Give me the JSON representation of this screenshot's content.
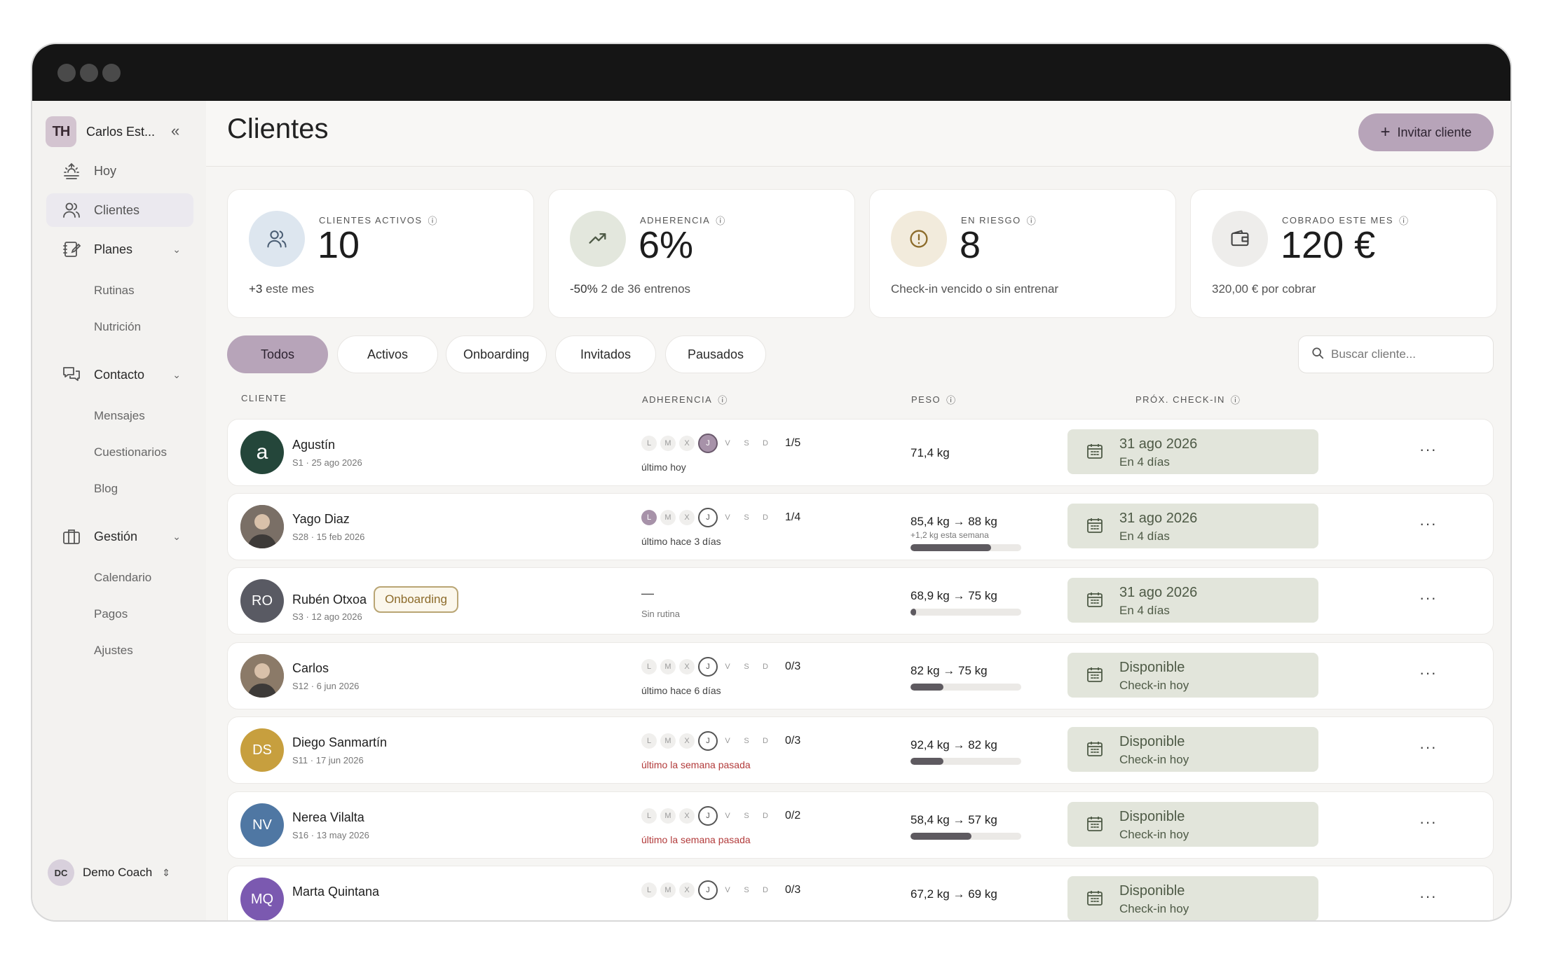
{
  "sidebar": {
    "brand_initials": "TH",
    "brand_name": "Carlos Est...",
    "nav": {
      "hoy": "Hoy",
      "clientes": "Clientes",
      "planes": "Planes",
      "rutinas": "Rutinas",
      "nutricion": "Nutrición",
      "contacto": "Contacto",
      "mensajes": "Mensajes",
      "cuestionarios": "Cuestionarios",
      "blog": "Blog",
      "gestion": "Gestión",
      "calendario": "Calendario",
      "pagos": "Pagos",
      "ajustes": "Ajustes"
    },
    "user": {
      "initials": "DC",
      "name": "Demo Coach"
    }
  },
  "header": {
    "title": "Clientes",
    "invite_label": "Invitar cliente"
  },
  "stats": [
    {
      "label": "CLIENTES ACTIVOS",
      "value": "10",
      "sub_strong": "+3",
      "sub": "este mes"
    },
    {
      "label": "ADHERENCIA",
      "value": "6%",
      "sub_strong": "-50%",
      "sub": "2 de 36 entrenos"
    },
    {
      "label": "EN RIESGO",
      "value": "8",
      "sub_strong": "",
      "sub": "Check-in vencido o sin entrenar"
    },
    {
      "label": "COBRADO ESTE MES",
      "value": "120 €",
      "sub_strong": "",
      "sub": "320,00 € por cobrar"
    }
  ],
  "tabs": [
    "Todos",
    "Activos",
    "Onboarding",
    "Invitados",
    "Pausados"
  ],
  "search": {
    "placeholder": "Buscar cliente..."
  },
  "columns": {
    "cliente": "CLIENTE",
    "adherencia": "ADHERENCIA",
    "peso": "PESO",
    "checkin": "PRÓX. CHECK-IN"
  },
  "weekdays": [
    "L",
    "M",
    "X",
    "J",
    "V",
    "S",
    "D"
  ],
  "clients": [
    {
      "initials": "a",
      "name": "Agustín",
      "badge": "",
      "meta": "S1 · 25 ago 2026",
      "days_done": [
        3
      ],
      "count": "1/5",
      "last": "último hoy",
      "last_warn": false,
      "weight": "71,4 kg",
      "weight_note": "",
      "progress": 0,
      "checkin_l1": "31 ago 2026",
      "checkin_l2": "En 4 días",
      "avatar_color": "#24463a"
    },
    {
      "initials": "",
      "name": "Yago Diaz",
      "badge": "",
      "meta": "S28 · 15 feb 2026",
      "days_done": [
        0
      ],
      "count": "1/4",
      "last": "último hace 3 días",
      "last_warn": false,
      "weight": "85,4 kg → 88 kg",
      "weight_note": "+1,2 kg esta semana",
      "progress": 0.73,
      "checkin_l1": "31 ago 2026",
      "checkin_l2": "En 4 días",
      "avatar_color": "#7a6f66"
    },
    {
      "initials": "RO",
      "name": "Rubén Otxoa",
      "badge": "Onboarding",
      "meta": "S3 · 12 ago 2026",
      "days_done": [],
      "count": "",
      "last": "—",
      "last_warn": false,
      "no_routine": "Sin rutina",
      "weight": "68,9 kg → 75 kg",
      "weight_note": "",
      "progress": 0.05,
      "checkin_l1": "31 ago 2026",
      "checkin_l2": "En 4 días",
      "avatar_color": "#595a63"
    },
    {
      "initials": "",
      "name": "Carlos",
      "badge": "",
      "meta": "S12 · 6 jun 2026",
      "days_done": [],
      "count": "0/3",
      "last": "último hace 6 días",
      "last_warn": false,
      "weight": "82 kg → 75 kg",
      "weight_note": "",
      "progress": 0.3,
      "checkin_l1": "Disponible",
      "checkin_l2": "Check-in hoy",
      "avatar_color": "#8b7a68"
    },
    {
      "initials": "DS",
      "name": "Diego Sanmartín",
      "badge": "",
      "meta": "S11 · 17 jun 2026",
      "days_done": [],
      "count": "0/3",
      "last": "último la semana pasada",
      "last_warn": true,
      "weight": "92,4 kg → 82 kg",
      "weight_note": "",
      "progress": 0.3,
      "checkin_l1": "Disponible",
      "checkin_l2": "Check-in hoy",
      "avatar_color": "#c79f3e"
    },
    {
      "initials": "NV",
      "name": "Nerea Vilalta",
      "badge": "",
      "meta": "S16 · 13 may 2026",
      "days_done": [],
      "count": "0/2",
      "last": "último la semana pasada",
      "last_warn": true,
      "weight": "58,4 kg → 57 kg",
      "weight_note": "",
      "progress": 0.55,
      "checkin_l1": "Disponible",
      "checkin_l2": "Check-in hoy",
      "avatar_color": "#4f77a3"
    },
    {
      "initials": "MQ",
      "name": "Marta Quintana",
      "badge": "",
      "meta": "",
      "days_done": [],
      "count": "0/3",
      "last": "",
      "last_warn": false,
      "weight": "67,2 kg → 69 kg",
      "weight_note": "",
      "progress": 0,
      "checkin_l1": "Disponible",
      "checkin_l2": "Check-in hoy",
      "avatar_color": "#7b59b0"
    }
  ]
}
